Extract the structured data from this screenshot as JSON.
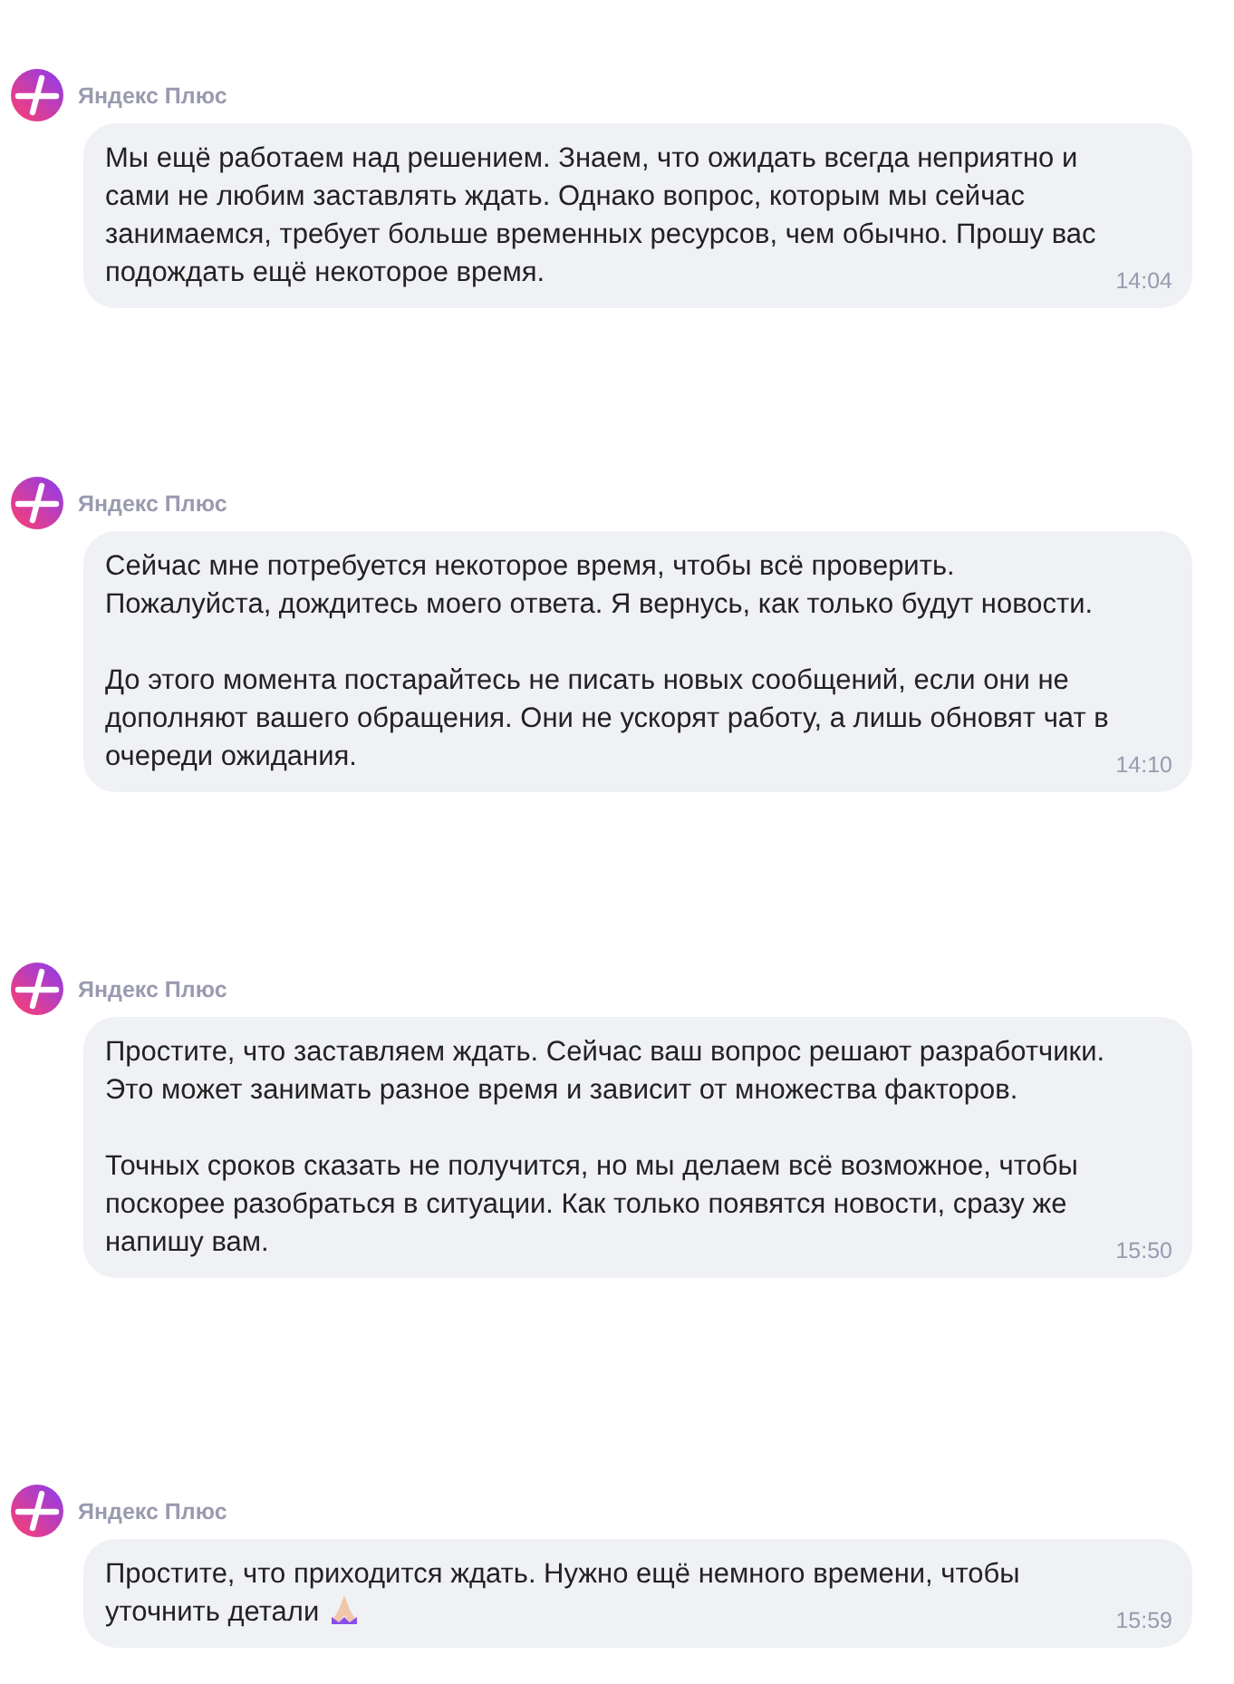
{
  "messages": [
    {
      "sender": "Яндекс Плюс",
      "paragraphs": [
        "Мы ещё работаем над решением. Знаем, что ожидать всегда неприятно и сами не любим заставлять ждать. Однако вопрос, которым мы сейчас занимаемся, требует больше временных ресурсов, чем обычно. Прошу вас подождать ещё некоторое время."
      ],
      "time": "14:04",
      "emoji": false
    },
    {
      "sender": "Яндекс Плюс",
      "paragraphs": [
        "Сейчас мне потребуется некоторое время, чтобы всё проверить. Пожалуйста, дождитесь моего ответа. Я вернусь, как только будут новости.",
        "До этого момента постарайтесь не писать новых сообщений, если они не дополняют вашего обращения. Они не ускорят работу, а лишь обновят чат в очереди ожидания."
      ],
      "time": "14:10",
      "emoji": false
    },
    {
      "sender": "Яндекс Плюс",
      "paragraphs": [
        "Простите, что заставляем ждать. Сейчас ваш вопрос решают разработчики. Это может занимать разное время и зависит от множества факторов.",
        "Точных сроков сказать не получится, но мы делаем всё возможное, чтобы поскорее разобраться в ситуации. Как только появятся новости, сразу же напишу вам."
      ],
      "time": "15:50",
      "emoji": false
    },
    {
      "sender": "Яндекс Плюс",
      "paragraphs": [
        "Простите, что приходится ждать. Нужно ещё немного времени, чтобы уточнить детали"
      ],
      "time": "15:59",
      "emoji": true
    }
  ]
}
